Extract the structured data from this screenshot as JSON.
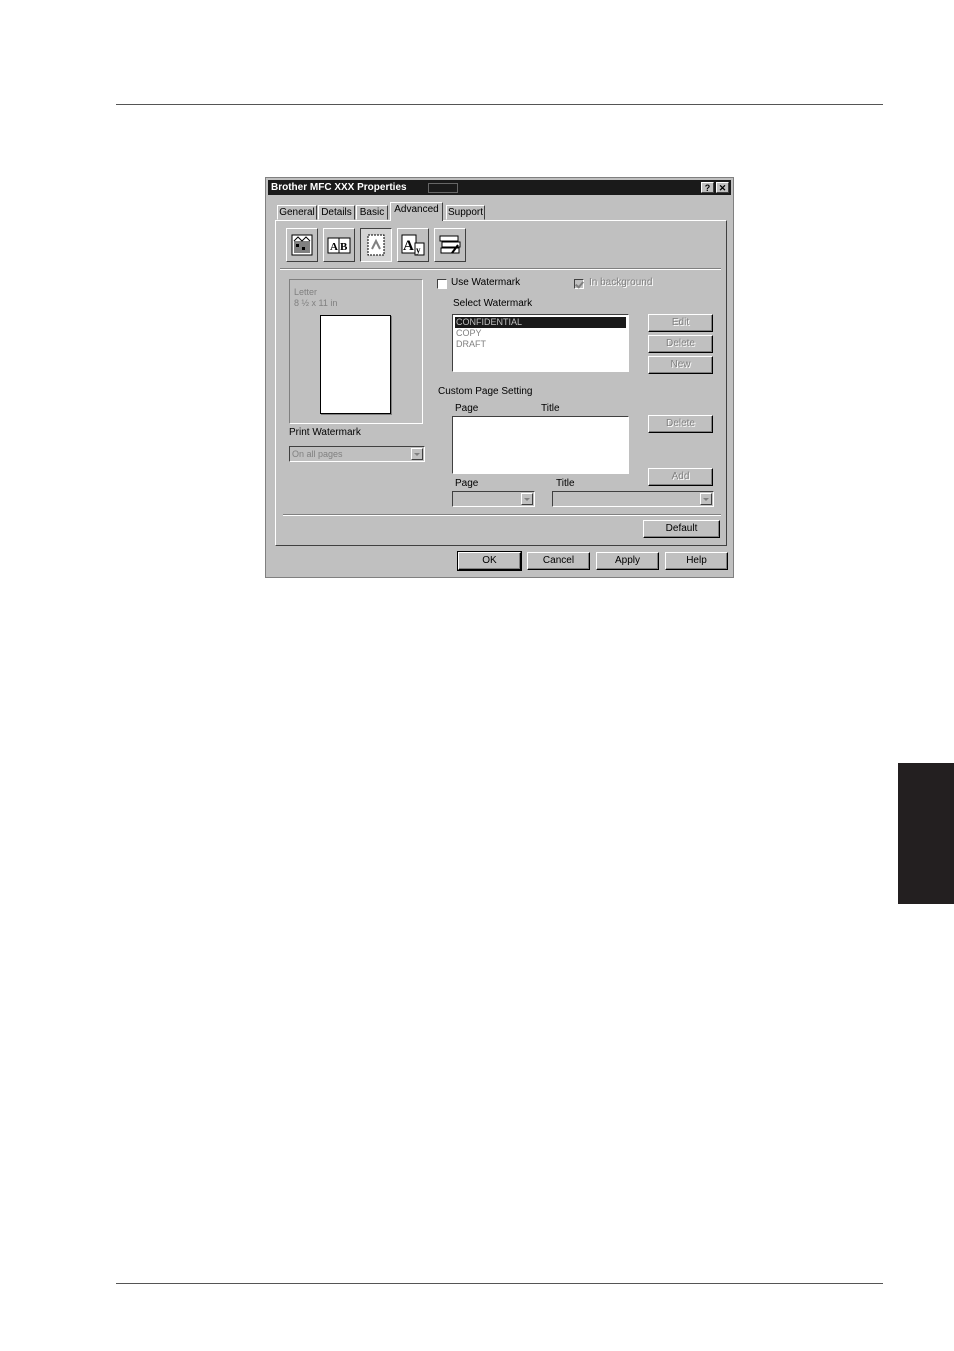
{
  "dialog": {
    "title": "Brother MFC XXX Properties",
    "help_label": "?",
    "close_label": "✕",
    "tabs": [
      {
        "label": "General"
      },
      {
        "label": "Details"
      },
      {
        "label": "Basic"
      },
      {
        "label": "Advanced"
      },
      {
        "label": "Support"
      }
    ],
    "active_tab": "Advanced",
    "toolbar_icons": [
      "quality-icon",
      "page-layout-icon",
      "watermark-icon",
      "font-icon",
      "device-options-icon"
    ],
    "preview": {
      "paper": "Letter",
      "size": "8 ½ x 11 in"
    },
    "use_watermark_label": "Use Watermark",
    "in_background_label": "In background",
    "select_watermark_label": "Select Watermark",
    "watermarks": [
      "CONFIDENTIAL",
      "COPY",
      "DRAFT"
    ],
    "watermark_buttons": {
      "edit": "Edit",
      "delete": "Delete",
      "new": "New"
    },
    "print_watermark_label": "Print Watermark",
    "print_watermark_value": "On all pages",
    "custom_page_setting_label": "Custom Page Setting",
    "custom_columns": {
      "page": "Page",
      "title": "Title"
    },
    "custom_buttons": {
      "delete": "Delete",
      "add": "Add"
    },
    "page_label": "Page",
    "title_label": "Title",
    "default_label": "Default",
    "footer_buttons": {
      "ok": "OK",
      "cancel": "Cancel",
      "apply": "Apply",
      "help": "Help"
    }
  }
}
